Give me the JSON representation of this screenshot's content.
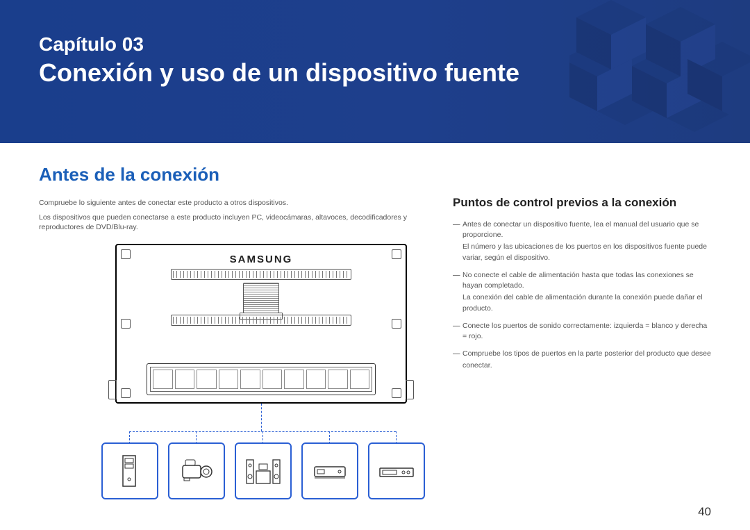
{
  "header": {
    "chapter_label": "Capítulo 03",
    "chapter_title": "Conexión y uso de un dispositivo fuente"
  },
  "left": {
    "section_title": "Antes de la conexión",
    "intro1": "Compruebe lo siguiente antes de conectar este producto a otros dispositivos.",
    "intro2": "Los dispositivos que pueden conectarse a este producto incluyen PC, videocámaras, altavoces, decodificadores y reproductores de DVD/Blu-ray.",
    "monitor_logo": "SAMSUNG"
  },
  "right": {
    "subsection_title": "Puntos de control previos a la conexión",
    "items": [
      {
        "line1": "Antes de conectar un dispositivo fuente, lea el manual del usuario que se proporcione.",
        "line2": "El número y las ubicaciones de los puertos en los dispositivos fuente puede variar, según el dispositivo."
      },
      {
        "line1": "No conecte el cable de alimentación hasta que todas las conexiones se hayan completado.",
        "line2": "La conexión del cable de alimentación durante la conexión puede dañar el producto."
      },
      {
        "line1": "Conecte los puertos de sonido correctamente: izquierda = blanco y derecha = rojo.",
        "line2": ""
      },
      {
        "line1": "Compruebe los tipos de puertos en la parte posterior del producto que desee",
        "line2": "conectar."
      }
    ]
  },
  "page_number": "40"
}
